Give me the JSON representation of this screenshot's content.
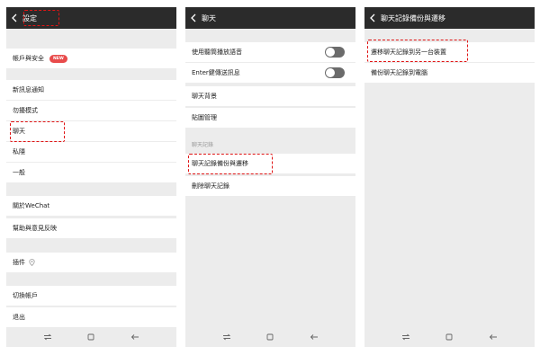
{
  "colors": {
    "topbar": "#2b2b2b",
    "background": "#ececec",
    "highlight": "#e01515",
    "badge": "#e84b4b"
  },
  "panel_settings": {
    "title": "設定",
    "items": [
      {
        "label": "帳戶與安全",
        "badge": "NEW"
      },
      {
        "label": "新訊息通知"
      },
      {
        "label": "勿擾模式"
      },
      {
        "label": "聊天"
      },
      {
        "label": "私隱"
      },
      {
        "label": "一般"
      },
      {
        "label": "關於WeChat"
      },
      {
        "label": "幫助與意見反映"
      },
      {
        "label": "插件",
        "icon": "location-pin-icon"
      },
      {
        "label": "切換帳戶"
      },
      {
        "label": "退出"
      }
    ]
  },
  "panel_chat": {
    "title": "聊天",
    "items": [
      {
        "label": "使用聽筒播放語音",
        "toggle": "off"
      },
      {
        "label": "Enter鍵傳送訊息",
        "toggle": "off"
      },
      {
        "label": "聊天背景"
      },
      {
        "label": "貼圖管理"
      }
    ],
    "section_label": "聊天記錄",
    "history_items": [
      {
        "label": "聊天記錄備份與遷移"
      },
      {
        "label": "刪除聊天記錄"
      }
    ]
  },
  "panel_backup": {
    "title": "聊天記錄備份與遷移",
    "items": [
      {
        "label": "遷移聊天記錄到另一台裝置"
      },
      {
        "label": "備份聊天記錄到電腦"
      }
    ]
  },
  "navbar_icons": [
    "recent-apps-icon",
    "home-icon",
    "back-nav-icon"
  ]
}
